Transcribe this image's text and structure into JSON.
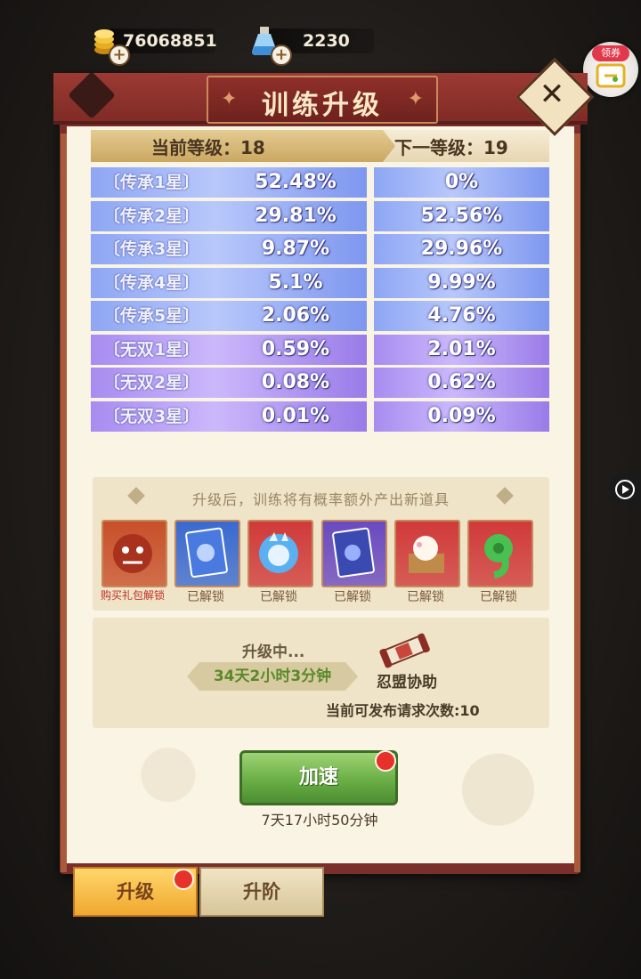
{
  "currency": {
    "gold_amount": "76068851",
    "potion_amount": "2230",
    "gold_icon": "gold-coin-icon",
    "potion_icon": "potion-flask-icon",
    "plus_symbol": "+"
  },
  "coupon": {
    "label": "领券",
    "icon": "ticket-icon"
  },
  "panel": {
    "title": "训练升级",
    "close_icon": "close-x-icon"
  },
  "level": {
    "current_label": "当前等级：18",
    "next_label": "下一等级：19"
  },
  "probabilities": [
    {
      "label": "〔传承1星〕",
      "current": "52.48%",
      "next": "0%",
      "tier": "blue"
    },
    {
      "label": "〔传承2星〕",
      "current": "29.81%",
      "next": "52.56%",
      "tier": "blue"
    },
    {
      "label": "〔传承3星〕",
      "current": "9.87%",
      "next": "29.96%",
      "tier": "blue"
    },
    {
      "label": "〔传承4星〕",
      "current": "5.1%",
      "next": "9.99%",
      "tier": "blue"
    },
    {
      "label": "〔传承5星〕",
      "current": "2.06%",
      "next": "4.76%",
      "tier": "blue"
    },
    {
      "label": "〔无双1星〕",
      "current": "0.59%",
      "next": "2.01%",
      "tier": "purple"
    },
    {
      "label": "〔无双2星〕",
      "current": "0.08%",
      "next": "0.62%",
      "tier": "purple"
    },
    {
      "label": "〔无双3星〕",
      "current": "0.01%",
      "next": "0.09%",
      "tier": "purple"
    }
  ],
  "items": {
    "caption": "升级后，训练将有概率额外产出新道具",
    "list": [
      {
        "status": "购买礼包解锁",
        "icon": "demon-mask-icon",
        "color": "#c8502a"
      },
      {
        "status": "已解锁",
        "icon": "blue-scroll-icon",
        "color": "#3a6ad0"
      },
      {
        "status": "已解锁",
        "icon": "water-spirit-icon",
        "color": "#d03a3a"
      },
      {
        "status": "已解锁",
        "icon": "purple-scroll-icon",
        "color": "#6a4ac0"
      },
      {
        "status": "已解锁",
        "icon": "rice-bucket-icon",
        "color": "#d03a3a"
      },
      {
        "status": "已解锁",
        "icon": "green-magatama-icon",
        "color": "#d03a3a"
      }
    ]
  },
  "upgrade": {
    "status": "升级中...",
    "remaining": "34天2小时3分钟",
    "guild_help_label": "忍盟协助",
    "guild_help_icon": "scroll-bundle-icon",
    "request_count_label": "当前可发布请求次数:10"
  },
  "speed_up": {
    "label": "加速",
    "time": "7天17小时50分钟"
  },
  "tabs": [
    {
      "label": "升级",
      "active": true
    },
    {
      "label": "升阶",
      "active": false
    }
  ],
  "colors": {
    "panel_red": "#7a2f2a",
    "blue_row": "#8ea6f4",
    "purple_row": "#a88cf0",
    "button_green": "#6aae45",
    "tab_gold": "#f0a830"
  }
}
